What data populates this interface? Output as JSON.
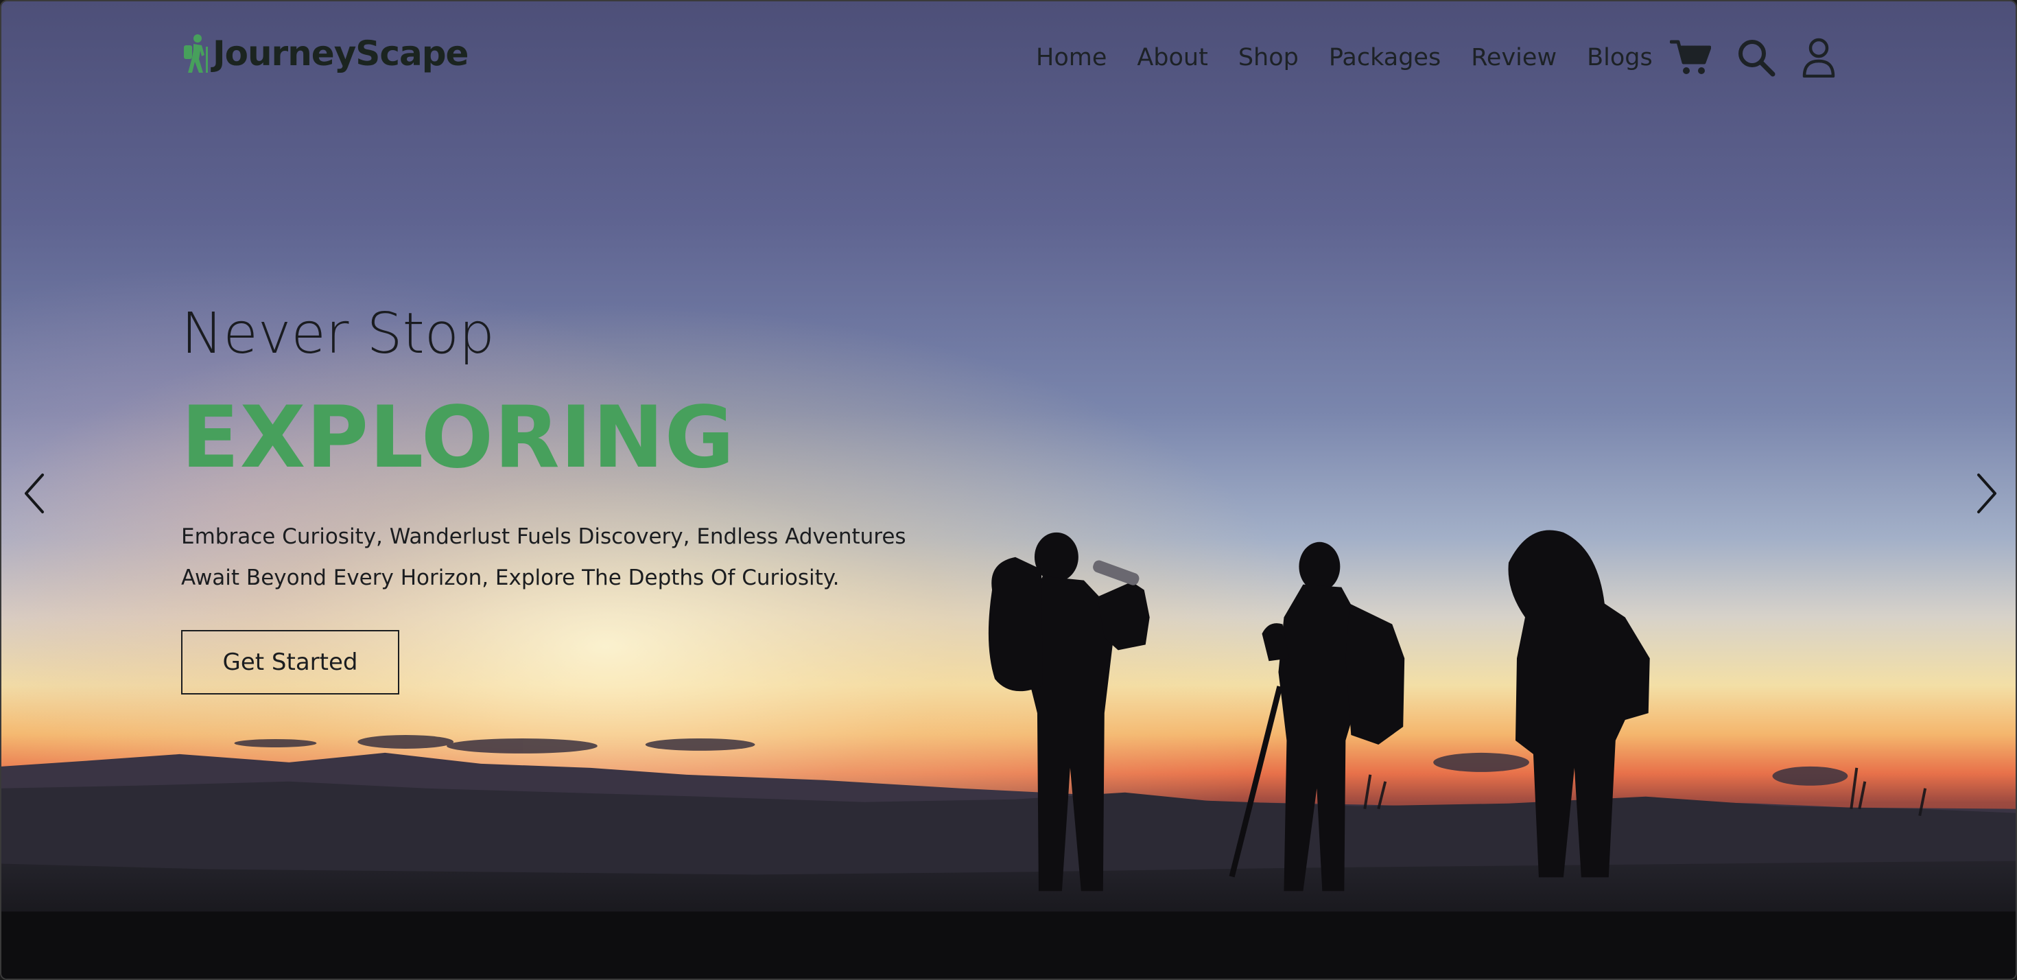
{
  "brand": {
    "name": "JourneyScape",
    "accent_color": "#47a05c",
    "logo_icon": "hiker-icon"
  },
  "nav": {
    "links": [
      "Home",
      "About",
      "Shop",
      "Packages",
      "Review",
      "Blogs"
    ],
    "icons": [
      "cart-icon",
      "search-icon",
      "user-icon"
    ]
  },
  "hero": {
    "kicker": "Never Stop",
    "title": "EXPLORING",
    "description_lines": [
      "Embrace Curiosity, Wanderlust Fuels Discovery, Endless Adventures",
      "Await Beyond Every Horizon, Explore The Depths Of Curiosity."
    ],
    "cta_label": "Get Started"
  },
  "slider": {
    "prev_icon": "chevron-left-icon",
    "next_icon": "chevron-right-icon"
  },
  "background": {
    "description_colors": {
      "sky_top": "#4f5378",
      "sky_mid": "#8a94b8",
      "horizon_glow": "#f4e3a8",
      "sunset": "#e9774a",
      "ground": "#111111"
    }
  }
}
